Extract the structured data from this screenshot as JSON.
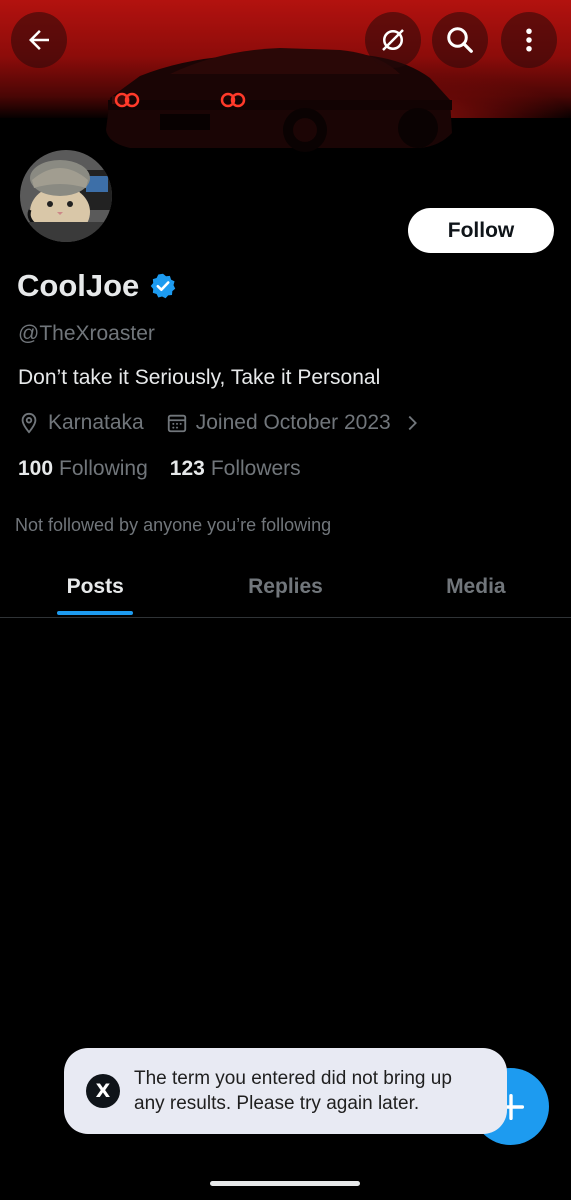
{
  "header": {
    "back_icon": "arrow-left-icon",
    "grok_icon": "grok-icon",
    "search_icon": "search-icon",
    "more_icon": "more-vertical-icon"
  },
  "profile": {
    "display_name": "CoolJoe",
    "handle": "@TheXroaster",
    "bio": "Don’t take it Seriously, Take it Personal",
    "location": "Karnataka",
    "joined": "Joined October 2023",
    "following_count": "100",
    "following_label": "Following",
    "followers_count": "123",
    "followers_label": "Followers",
    "not_followed_text": "Not followed by anyone you’re following",
    "follow_label": "Follow",
    "verified": true
  },
  "tabs": [
    {
      "label": "Posts",
      "active": true
    },
    {
      "label": "Replies",
      "active": false
    },
    {
      "label": "Media",
      "active": false
    }
  ],
  "toast": {
    "logo": "X",
    "message": "The term you entered did not bring up any results. Please try again later."
  },
  "colors": {
    "accent": "#1d9bf0",
    "background": "#000000",
    "muted": "#71767b",
    "text": "#e7e9ea"
  }
}
